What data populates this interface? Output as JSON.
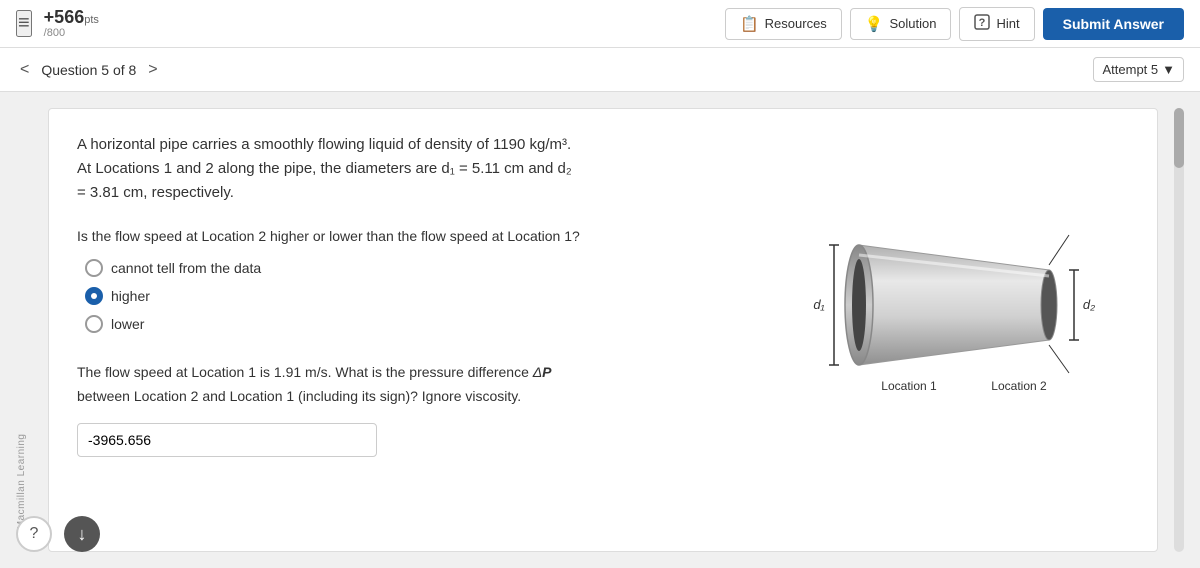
{
  "topbar": {
    "points": "+566",
    "pts_label": "pts",
    "points_denom": "/800",
    "resources_label": "Resources",
    "solution_label": "Solution",
    "hint_label": "Hint",
    "submit_label": "Submit Answer"
  },
  "question_bar": {
    "question_label": "Question 5 of 8",
    "attempt_label": "Attempt 5",
    "chevron": "▼"
  },
  "watermark": "© Macmillan Learning",
  "question": {
    "text": "A horizontal pipe carries a smoothly flowing liquid of density of 1190 kg/m³. At Locations 1 and 2 along the pipe, the diameters are d₁ = 5.11 cm and d₂ = 3.81 cm, respectively.",
    "part1": {
      "question": "Is the flow speed at Location 2 higher or lower than the flow speed at Location 1?",
      "options": [
        {
          "id": "opt1",
          "label": "cannot tell from the data",
          "selected": false
        },
        {
          "id": "opt2",
          "label": "higher",
          "selected": true
        },
        {
          "id": "opt3",
          "label": "lower",
          "selected": false
        }
      ]
    },
    "part2": {
      "text": "The flow speed at Location 1 is 1.91 m/s. What is the pressure difference ΔP between Location 2 and Location 1 (including its sign)? Ignore viscosity.",
      "input_value": "-3965.656",
      "input_placeholder": "-3965.656"
    }
  },
  "diagram": {
    "label_d1": "d₁",
    "label_d2": "d₂",
    "label_loc1": "Location 1",
    "label_loc2": "Location 2"
  },
  "icons": {
    "hamburger": "≡",
    "resources": "📋",
    "solution": "💡",
    "hint": "?",
    "arrow_left": "<",
    "arrow_right": ">",
    "help": "?",
    "download": "↓"
  }
}
